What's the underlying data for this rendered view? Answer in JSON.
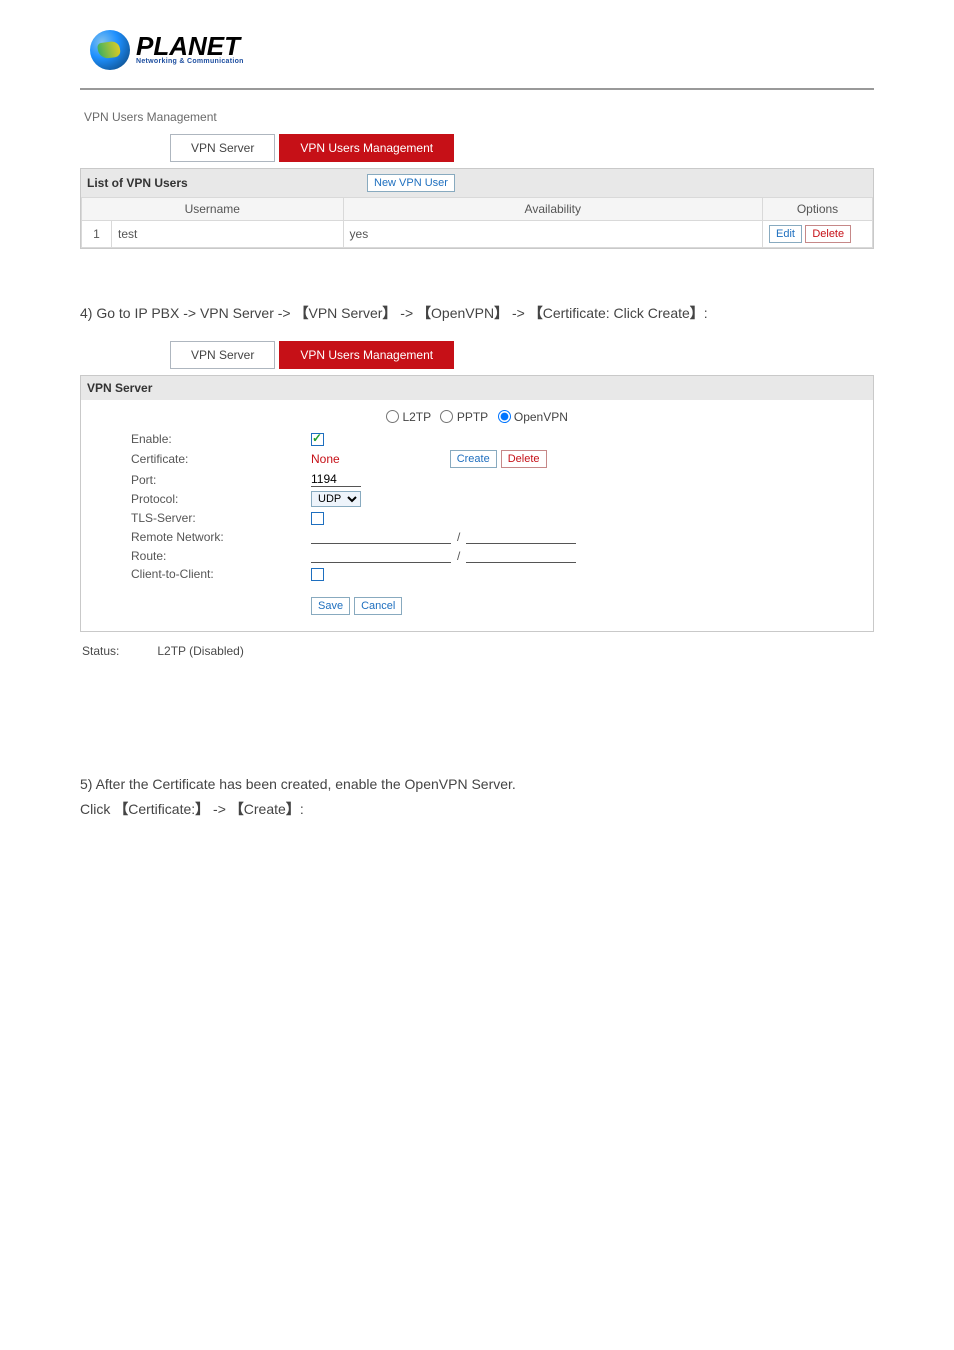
{
  "logo": {
    "brand": "PLANET",
    "tagline": "Networking & Communication"
  },
  "section1": {
    "crumb": "VPN Users Management",
    "tabs": {
      "server": "VPN Server",
      "users": "VPN Users Management"
    },
    "panel_title": "List of VPN Users",
    "new_user_btn": "New VPN User",
    "headers": {
      "username": "Username",
      "availability": "Availability",
      "options": "Options"
    },
    "rows": [
      {
        "idx": "1",
        "username": "test",
        "availability": "yes"
      }
    ],
    "edit": "Edit",
    "delete": "Delete"
  },
  "instr1": {
    "pre": "4) Go to IP PBX -> VPN Server -> ",
    "b1": "VPN Server",
    "sep1": " -> ",
    "b2": "OpenVPN",
    "sep2": " -> ",
    "b3": "Certificate:",
    "click": " Click ",
    "b4": "Create"
  },
  "section2": {
    "tabs": {
      "server": "VPN Server",
      "users": "VPN Users Management"
    },
    "panel_title": "VPN Server",
    "radios": {
      "l2tp": "L2TP",
      "pptp": "PPTP",
      "openvpn": "OpenVPN"
    },
    "fields": {
      "enable": "Enable:",
      "certificate": "Certificate:",
      "cert_value": "None",
      "create": "Create",
      "delete": "Delete",
      "port": "Port:",
      "port_value": "1194",
      "protocol": "Protocol:",
      "protocol_value": "UDP",
      "tls": "TLS-Server:",
      "remote": "Remote Network:",
      "route": "Route:",
      "c2c": "Client-to-Client:"
    },
    "save": "Save",
    "cancel": "Cancel",
    "status_label": "Status:",
    "status_value": "L2TP (Disabled)"
  },
  "instr2": {
    "text1": "5) After the Certificate has been created, enable the OpenVPN Server.",
    "click": "Click ",
    "b1": "Certificate:",
    "sep": " -> ",
    "b2": "Create"
  }
}
